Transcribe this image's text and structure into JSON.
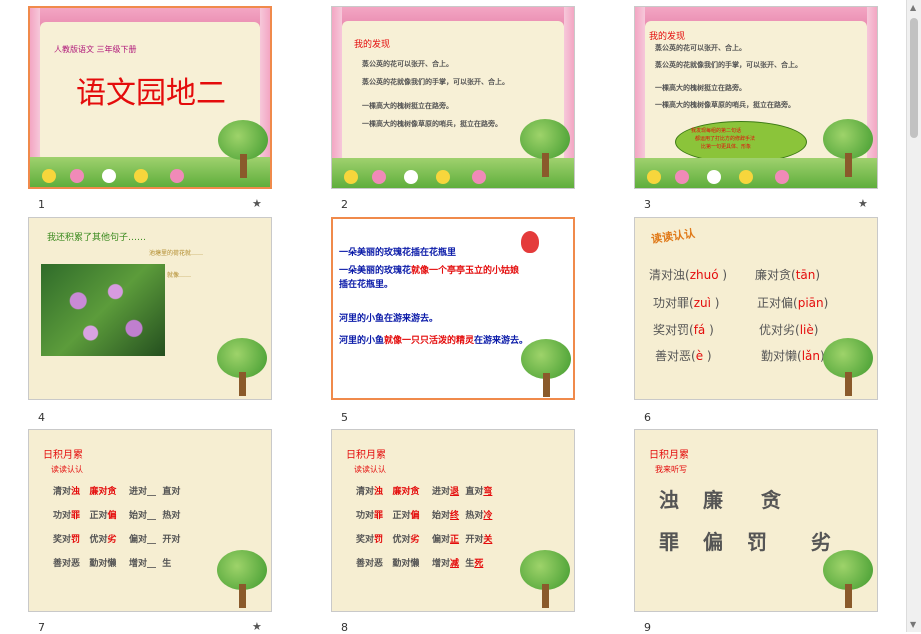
{
  "slides": [
    {
      "num": "1",
      "star": "★",
      "subtitle": "人教版语文  三年级下册",
      "title": "语文园地二"
    },
    {
      "num": "2",
      "heading": "我的发现",
      "lines": [
        "蒸公英的花可以张开、合上。",
        "蒸公英的花就像我们的手掌，可以张开、合上。",
        "一棵高大的槐树挺立在路旁。",
        "一棵高大的槐树像草原的哨兵，挺立在路旁。"
      ]
    },
    {
      "num": "3",
      "star": "★",
      "heading": "我的发现",
      "lines": [
        "蒸公英的花可以张开、合上。",
        "蒸公英的花就像我们的手掌，可以张开、合上。",
        "一棵高大的槐树挺立在路旁。",
        "一棵高大的槐树像草原的哨兵，挺立在路旁。"
      ],
      "bubble": [
        "我发现每组的第二句话",
        "都运用了打比方的修辞手法",
        "比第一句更具体、形象"
      ]
    },
    {
      "num": "4",
      "heading": "我还积累了其他句子……",
      "note1": "池塘里的荷花就……",
      "note2": "就像……"
    },
    {
      "num": "5",
      "p1": "一朵美丽的玫瑰花插在花瓶里",
      "p2a": "一朵美丽的玫瑰花",
      "p2b": "就像一个亭亭玉立的小姑娘",
      "p2c": "插在花瓶里。",
      "p3": "河里的小鱼在游来游去。",
      "p4a": "河里的小鱼",
      "p4b": "就像一只只活泼的精灵",
      "p4c": "在游来游去。"
    },
    {
      "num": "6",
      "heading": "读读认认",
      "pairs": [
        {
          "w": "清对浊",
          "p": "zhuó"
        },
        {
          "w": "廉对贪",
          "p": "tān"
        },
        {
          "w": "功对罪",
          "p": "zuì"
        },
        {
          "w": "正对偏",
          "p": "piān"
        },
        {
          "w": "奖对罚",
          "p": "fá"
        },
        {
          "w": "优对劣",
          "p": "liè"
        },
        {
          "w": "善对恶",
          "p": "è"
        },
        {
          "w": "勤对懒",
          "p": "lǎn"
        }
      ]
    },
    {
      "num": "7",
      "star": "★",
      "heading": "日积月累",
      "sub": "读读认认",
      "rows": [
        [
          "清对",
          "浊",
          "廉对",
          "贪",
          "进对__",
          "直对"
        ],
        [
          "功对",
          "罪",
          "正对",
          "偏",
          "始对__",
          "热对"
        ],
        [
          "奖对",
          "罚",
          "优对",
          "劣",
          "偏对__",
          "开对"
        ],
        [
          "善对恶",
          "",
          "勤对懒",
          "",
          "增对__",
          "生"
        ]
      ]
    },
    {
      "num": "8",
      "heading": "日积月累",
      "sub": "读读认认",
      "rows": [
        [
          "清对",
          "浊",
          "廉对",
          "贪",
          "进对",
          "退",
          "直对",
          "弯"
        ],
        [
          "功对",
          "罪",
          "正对",
          "偏",
          "始对",
          "终",
          "热对",
          "冷"
        ],
        [
          "奖对",
          "罚",
          "优对",
          "劣",
          "偏对",
          "正",
          "开对",
          "关"
        ],
        [
          "善对恶",
          "",
          "勤对懒",
          "",
          "增对",
          "减",
          "生",
          "死"
        ]
      ]
    },
    {
      "num": "9",
      "heading": "日积月累",
      "sub": "我来听写",
      "row1": [
        "浊",
        "廉",
        "贪"
      ],
      "row2": [
        "罪",
        "偏",
        "罚",
        "劣"
      ]
    }
  ]
}
